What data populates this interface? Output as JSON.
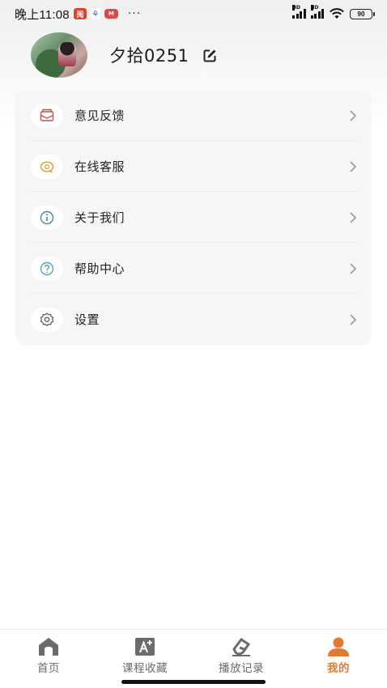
{
  "status_bar": {
    "time": "晚上11:08",
    "app_icons": [
      "阅",
      "⚘",
      "M"
    ],
    "more": "···",
    "signal_hd": "HD",
    "battery": "90"
  },
  "profile": {
    "username": "夕拾0251"
  },
  "menu": [
    {
      "label": "意见反馈",
      "icon": "mail-feedback-icon"
    },
    {
      "label": "在线客服",
      "icon": "chat-support-icon"
    },
    {
      "label": "关于我们",
      "icon": "info-icon"
    },
    {
      "label": "帮助中心",
      "icon": "help-icon"
    },
    {
      "label": "设置",
      "icon": "gear-icon"
    }
  ],
  "bottom_nav": [
    {
      "label": "首页",
      "icon": "home-icon",
      "active": false
    },
    {
      "label": "课程收藏",
      "icon": "course-favorite-icon",
      "active": false
    },
    {
      "label": "播放记录",
      "icon": "play-history-icon",
      "active": false
    },
    {
      "label": "我的",
      "icon": "user-icon",
      "active": true
    }
  ],
  "colors": {
    "accent": "#e37a2c",
    "card_bg": "#f6f6f6",
    "inactive": "#6a6a6a"
  }
}
